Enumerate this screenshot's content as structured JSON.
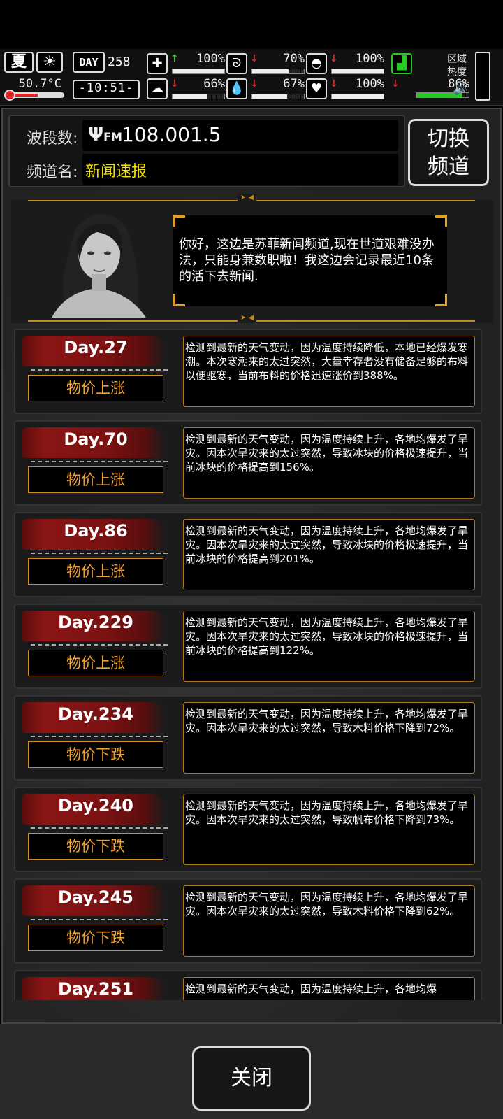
{
  "hud": {
    "season": "夏",
    "temperature": "50.7°C",
    "day_label": "DAY",
    "day_value": "258",
    "clock": "-10:51-",
    "stats": [
      {
        "icon": "medkit-icon",
        "glyph": "✚",
        "trend": "up",
        "pct": "100%",
        "level": 1.0
      },
      {
        "icon": "stomach-icon",
        "glyph": "ᘐ",
        "trend": "down",
        "pct": "70%",
        "level": 0.7
      },
      {
        "icon": "pill-icon",
        "glyph": "◓",
        "trend": "down",
        "pct": "100%",
        "level": 1.0
      },
      {
        "icon": "brain-icon",
        "glyph": "☁",
        "trend": "down",
        "pct": "66%",
        "level": 0.66
      },
      {
        "icon": "water-drop-icon",
        "glyph": "💧",
        "trend": "down",
        "pct": "67%",
        "level": 0.67
      },
      {
        "icon": "heart-icon",
        "glyph": "♥",
        "trend": "down",
        "pct": "100%",
        "level": 1.0
      },
      {
        "icon": "boot-icon",
        "glyph": "▟",
        "trend": "down",
        "pct": "86%",
        "level": 0.86
      }
    ],
    "region_label": "区域热度"
  },
  "radio": {
    "band_label": "波段数:",
    "frequency": "108.001.5",
    "channel_label": "频道名:",
    "channel_name": "新闻速报",
    "switch_label_1": "切换",
    "switch_label_2": "频道"
  },
  "anchor": {
    "message": "你好，这边是苏菲新闻频道,现在世道艰难没办法，只能身兼数职啦！我这边会记录最近10条的活下去新闻."
  },
  "news": [
    {
      "day": "Day.27",
      "tag": "物价上涨",
      "text": "检测到最新的天气变动，因为温度持续降低，本地已经爆发寒潮。本次寒潮来的太过突然，大量幸存者没有储备足够的布料以便驱寒，当前布料的价格迅速涨价到388%。"
    },
    {
      "day": "Day.70",
      "tag": "物价上涨",
      "text": "检测到最新的天气变动，因为温度持续上升，各地均爆发了旱灾。因本次旱灾来的太过突然，导致冰块的价格极速提升，当前冰块的价格提高到156%。"
    },
    {
      "day": "Day.86",
      "tag": "物价上涨",
      "text": "检测到最新的天气变动，因为温度持续上升，各地均爆发了旱灾。因本次旱灾来的太过突然，导致冰块的价格极速提升，当前冰块的价格提高到201%。"
    },
    {
      "day": "Day.229",
      "tag": "物价上涨",
      "text": "检测到最新的天气变动，因为温度持续上升，各地均爆发了旱灾。因本次旱灾来的太过突然，导致冰块的价格极速提升，当前冰块的价格提高到122%。"
    },
    {
      "day": "Day.234",
      "tag": "物价下跌",
      "text": "检测到最新的天气变动，因为温度持续上升，各地均爆发了旱灾。因本次旱灾来的太过突然，导致木料价格下降到72%。"
    },
    {
      "day": "Day.240",
      "tag": "物价下跌",
      "text": "检测到最新的天气变动，因为温度持续上升，各地均爆发了旱灾。因本次旱灾来的太过突然，导致帆布价格下降到73%。"
    },
    {
      "day": "Day.245",
      "tag": "物价下跌",
      "text": "检测到最新的天气变动，因为温度持续上升，各地均爆发了旱灾。因本次旱灾来的太过突然，导致木料价格下降到62%。"
    },
    {
      "day": "Day.251",
      "tag": "",
      "text": "检测到最新的天气变动，因为温度持续上升，各地均爆"
    }
  ],
  "close_label": "关闭"
}
